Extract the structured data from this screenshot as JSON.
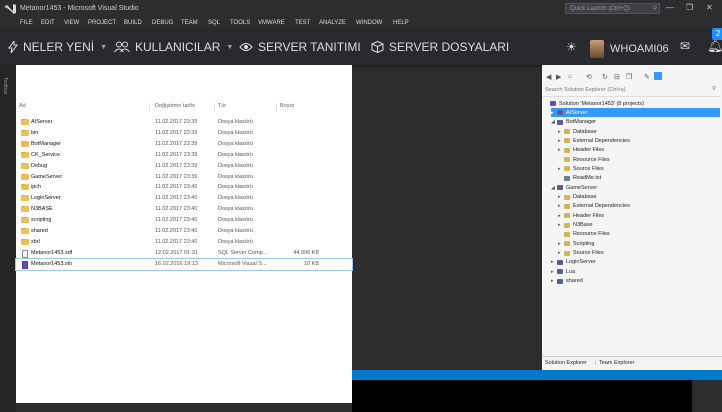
{
  "titlebar": {
    "title": "Metanor1453 - Microsoft Visual Studio",
    "quick_launch_placeholder": "Quick Launch (Ctrl+Q)"
  },
  "menubar": [
    "FILE",
    "EDIT",
    "VIEW",
    "PROJECT",
    "BUILD",
    "DEBUG",
    "TEAM",
    "SQL",
    "TOOLS",
    "VMWARE",
    "TEST",
    "ANALYZE",
    "WINDOW",
    "HELP"
  ],
  "nav": {
    "new": "NELER YENİ",
    "users": "KULLANICILAR",
    "server_intro": "SERVER TANITIMI",
    "server_files": "SERVER DOSYALARI",
    "username": "WHOAMI06",
    "badge": "2"
  },
  "left_strip_text": "Toolbox",
  "explorer": {
    "columns": [
      "Ad",
      "Değiştirme tarihi",
      "Tür",
      "Boyut"
    ],
    "rows": [
      {
        "name": "AIServer",
        "date": "11.02.2017 23:39",
        "type": "Dosya klasörü",
        "size": "",
        "icon": "folder"
      },
      {
        "name": "bin",
        "date": "11.02.2017 23:39",
        "type": "Dosya klasörü",
        "size": "",
        "icon": "folder"
      },
      {
        "name": "BotManager",
        "date": "11.02.2017 23:39",
        "type": "Dosya klasörü",
        "size": "",
        "icon": "folder"
      },
      {
        "name": "CK_Service",
        "date": "11.02.2017 23:39",
        "type": "Dosya klasörü",
        "size": "",
        "icon": "folder"
      },
      {
        "name": "Debug",
        "date": "11.02.2017 23:39",
        "type": "Dosya klasörü",
        "size": "",
        "icon": "folder"
      },
      {
        "name": "GameServer",
        "date": "11.02.2017 23:39",
        "type": "Dosya klasörü",
        "size": "",
        "icon": "folder"
      },
      {
        "name": "ipch",
        "date": "11.02.2017 23:40",
        "type": "Dosya klasörü",
        "size": "",
        "icon": "folder"
      },
      {
        "name": "LoginServer",
        "date": "11.02.2017 23:40",
        "type": "Dosya klasörü",
        "size": "",
        "icon": "folder"
      },
      {
        "name": "N3BASE",
        "date": "11.02.2017 23:40",
        "type": "Dosya klasörü",
        "size": "",
        "icon": "folder"
      },
      {
        "name": "scripting",
        "date": "11.02.2017 23:40",
        "type": "Dosya klasörü",
        "size": "",
        "icon": "folder"
      },
      {
        "name": "shared",
        "date": "11.02.2017 23:40",
        "type": "Dosya klasörü",
        "size": "",
        "icon": "folder"
      },
      {
        "name": "xbrl",
        "date": "11.02.2017 23:40",
        "type": "Dosya klasörü",
        "size": "",
        "icon": "folder"
      },
      {
        "name": "Metanor1453.sdf",
        "date": "12.02.2017 01:31",
        "type": "SQL Server Comp...",
        "size": "44.096 KB",
        "icon": "file"
      },
      {
        "name": "Metanor1453.sln",
        "date": "16.02.2016 19:13",
        "type": "Microsoft Visual S...",
        "size": "10 KB",
        "icon": "sln"
      }
    ]
  },
  "solution_explorer": {
    "search_placeholder": "Search Solution Explorer (Ctrl+ş)",
    "tree": [
      {
        "label": "Solution 'Metanor1453' (8 projects)",
        "icon": "sol",
        "indent": 0,
        "exp": ""
      },
      {
        "label": "AIServer",
        "icon": "proj",
        "indent": 1,
        "exp": "▸",
        "selected": true
      },
      {
        "label": "BotManager",
        "icon": "proj",
        "indent": 1,
        "exp": "◢"
      },
      {
        "label": "Database",
        "icon": "folder",
        "indent": 2,
        "exp": "▸"
      },
      {
        "label": "External Dependencies",
        "icon": "folder",
        "indent": 2,
        "exp": "▸"
      },
      {
        "label": "Header Files",
        "icon": "folder",
        "indent": 2,
        "exp": "▸"
      },
      {
        "label": "Resource Files",
        "icon": "folder",
        "indent": 2,
        "exp": ""
      },
      {
        "label": "Source Files",
        "icon": "folder",
        "indent": 2,
        "exp": "▸"
      },
      {
        "label": "ReadMe.txt",
        "icon": "file",
        "indent": 2,
        "exp": ""
      },
      {
        "label": "GameServer",
        "icon": "proj",
        "indent": 1,
        "exp": "◢"
      },
      {
        "label": "Database",
        "icon": "folder",
        "indent": 2,
        "exp": "▸"
      },
      {
        "label": "External Dependencies",
        "icon": "folder",
        "indent": 2,
        "exp": "▸"
      },
      {
        "label": "Header Files",
        "icon": "folder",
        "indent": 2,
        "exp": "▸"
      },
      {
        "label": "N3Base",
        "icon": "folder",
        "indent": 2,
        "exp": "▸"
      },
      {
        "label": "Resource Files",
        "icon": "folder",
        "indent": 2,
        "exp": ""
      },
      {
        "label": "Scripting",
        "icon": "folder",
        "indent": 2,
        "exp": "▸"
      },
      {
        "label": "Source Files",
        "icon": "folder",
        "indent": 2,
        "exp": "▸"
      },
      {
        "label": "LoginServer",
        "icon": "proj",
        "indent": 1,
        "exp": "▸"
      },
      {
        "label": "Lua",
        "icon": "proj",
        "indent": 1,
        "exp": "▸"
      },
      {
        "label": "shared",
        "icon": "proj",
        "indent": 1,
        "exp": "▸"
      }
    ],
    "tabs": [
      "Solution Explorer",
      "Team Explorer"
    ]
  },
  "colors": {
    "accent": "#007acc",
    "selection": "#3399ff",
    "nav_bg": "#292a2e"
  }
}
